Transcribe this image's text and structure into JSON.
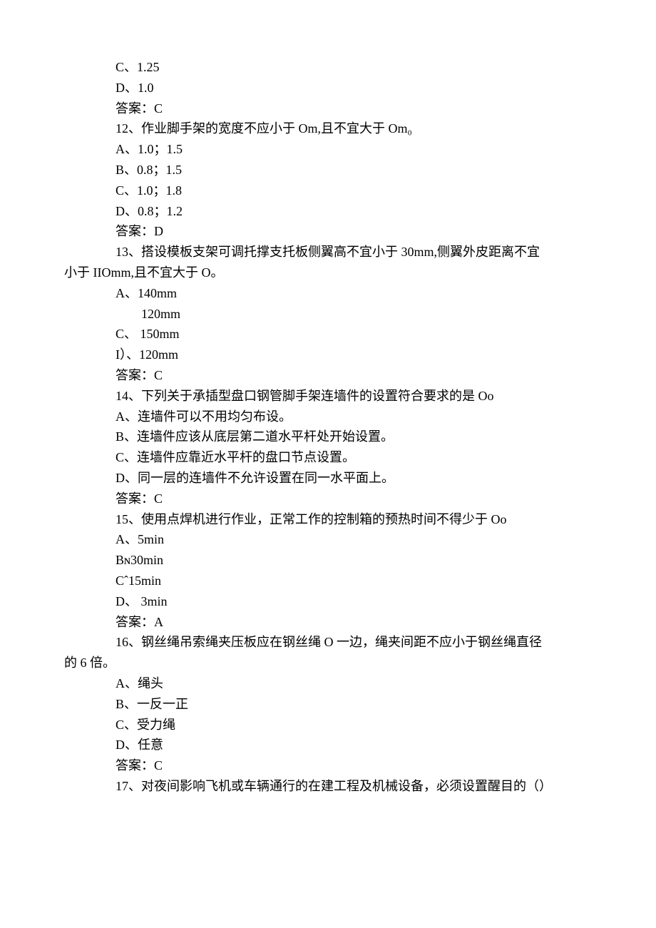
{
  "lines": [
    {
      "cls": "indent1",
      "text": "C、1.25"
    },
    {
      "cls": "indent1",
      "text": "D、1.0"
    },
    {
      "cls": "indent1",
      "text": "答案：C"
    },
    {
      "cls": "indent1",
      "text": "12、作业脚手架的宽度不应小于 Om,且不宜大于 Om₀"
    },
    {
      "cls": "indent1",
      "text": "A、1.0；1.5"
    },
    {
      "cls": "indent1",
      "text": "B、0.8；1.5"
    },
    {
      "cls": "indent1",
      "text": "C、1.0；1.8"
    },
    {
      "cls": "indent1",
      "text": "D、0.8；1.2"
    },
    {
      "cls": "indent1",
      "text": "答案：D"
    },
    {
      "cls": "indent1",
      "text": "13、搭设模板支架可调托撑支托板侧翼高不宜小于 30mm,侧翼外皮距离不宜"
    },
    {
      "cls": "cont",
      "text": "小于 IIOmm,且不宜大于 O。"
    },
    {
      "cls": "indent1",
      "text": "A、140mm"
    },
    {
      "cls": "indent2",
      "text": "120mm"
    },
    {
      "cls": "indent1",
      "text": "C、 150mm"
    },
    {
      "cls": "indent1",
      "text": "I）、120mm"
    },
    {
      "cls": "indent1",
      "text": "答案：C"
    },
    {
      "cls": "indent1",
      "text": "14、下列关于承插型盘口钢管脚手架连墙件的设置符合要求的是 Oo"
    },
    {
      "cls": "indent1",
      "text": "A、连墙件可以不用均匀布设。"
    },
    {
      "cls": "indent1",
      "text": "B、连墙件应该从底层第二道水平杆处开始设置。"
    },
    {
      "cls": "indent1",
      "text": "C、连墙件应靠近水平杆的盘口节点设置。"
    },
    {
      "cls": "indent1",
      "text": "D、同一层的连墙件不允许设置在同一水平面上。"
    },
    {
      "cls": "indent1",
      "text": "答案：C"
    },
    {
      "cls": "indent1",
      "text": "15、使用点焊机进行作业，正常工作的控制箱的预热时间不得少于 Oo"
    },
    {
      "cls": "indent1",
      "text": "A、5min"
    },
    {
      "cls": "indent1",
      "text": "Bɴ30min"
    },
    {
      "cls": "indent1",
      "text": "Cˆ15min"
    },
    {
      "cls": "indent1",
      "text": "D、 3min"
    },
    {
      "cls": "indent1",
      "text": "答案：A"
    },
    {
      "cls": "indent1",
      "text": "16、钢丝绳吊索绳夹压板应在钢丝绳 O 一边，绳夹间距不应小于钢丝绳直径"
    },
    {
      "cls": "cont",
      "text": "的 6 倍。"
    },
    {
      "cls": "indent1",
      "text": "A、绳头"
    },
    {
      "cls": "indent1",
      "text": "B、一反一正"
    },
    {
      "cls": "indent1",
      "text": "C、受力绳"
    },
    {
      "cls": "indent1",
      "text": "D、任意"
    },
    {
      "cls": "indent1",
      "text": "答案：C"
    },
    {
      "cls": "indent1",
      "text": "17、对夜间影响飞机或车辆通行的在建工程及机械设备，必须设置醒目的（）"
    }
  ]
}
